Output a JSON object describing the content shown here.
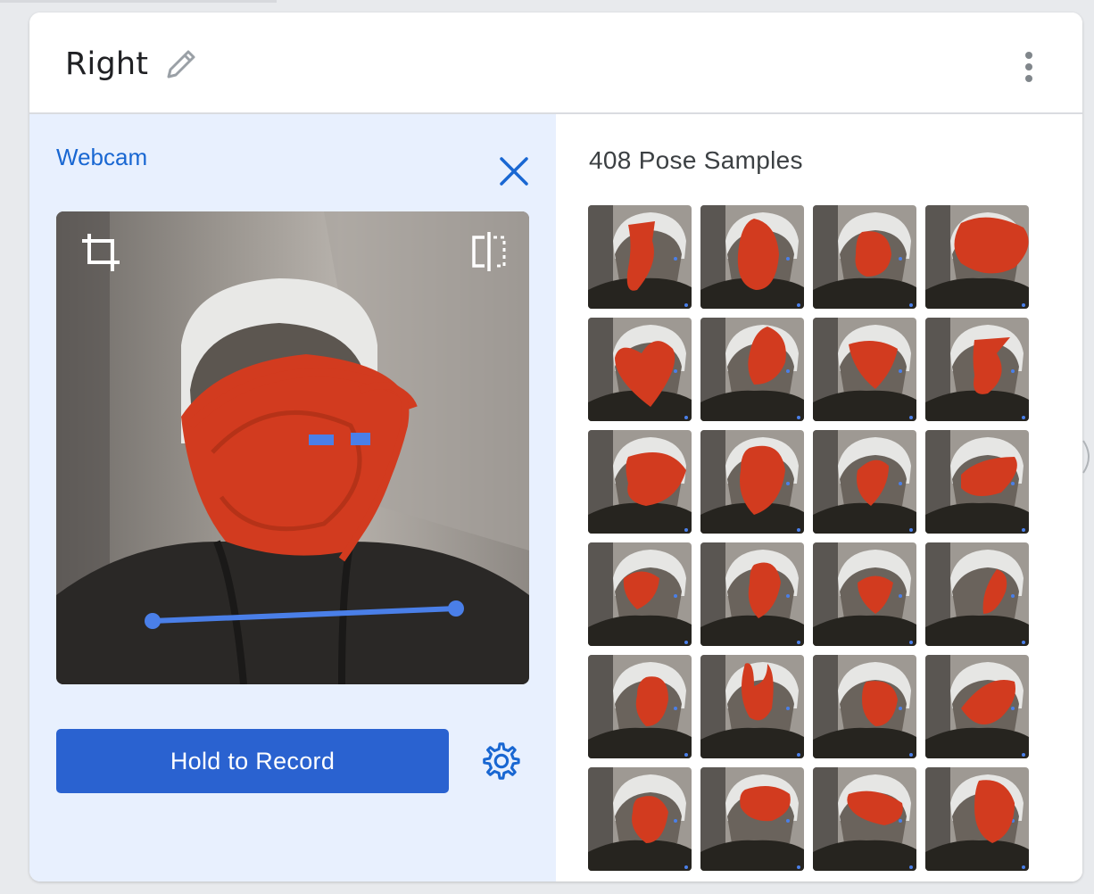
{
  "header": {
    "class_name": "Right",
    "edit_icon": "pencil-icon",
    "menu_icon": "more-vert-icon"
  },
  "webcam": {
    "label": "Webcam",
    "close_icon": "close-icon",
    "crop_icon": "crop-icon",
    "flip_icon": "flip-icon",
    "record_label": "Hold to Record",
    "settings_icon": "gear-icon"
  },
  "samples": {
    "title": "408 Pose Samples",
    "columns": 4,
    "visible_rows": 6
  },
  "colors": {
    "accent": "#1967d2",
    "button": "#2a62d0",
    "panel_bg": "#e8f0fe",
    "redaction": "#d23b1f",
    "pose_line": "#4a7fe8"
  }
}
